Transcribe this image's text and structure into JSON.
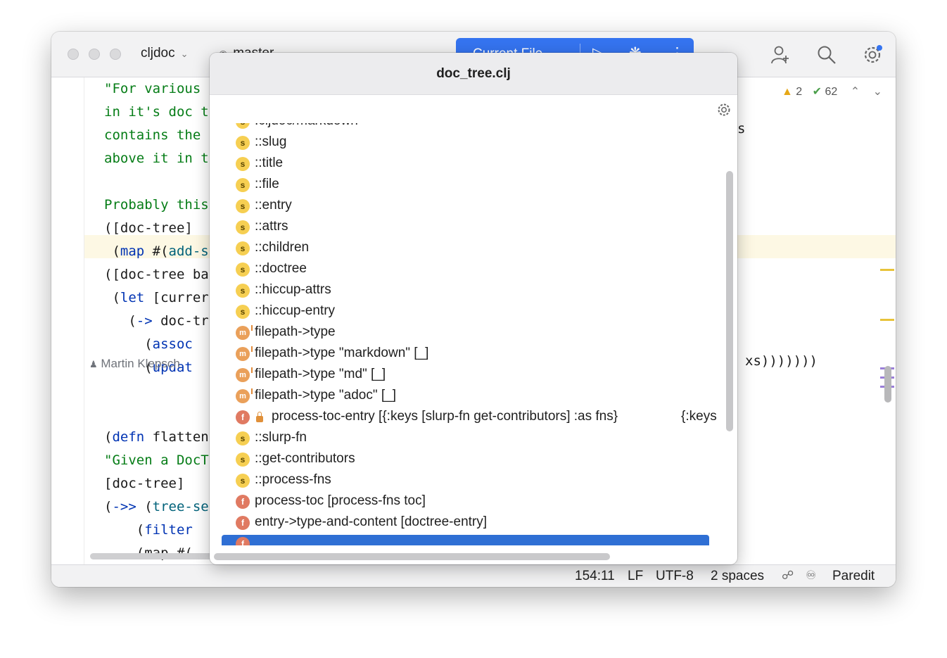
{
  "titlebar": {
    "project": "cljdoc",
    "branch": "master",
    "run_config": "Current File"
  },
  "editor": {
    "lines": [
      {
        "segments": [
          {
            "t": "\"For various ",
            "c": "str"
          }
        ]
      },
      {
        "segments": [
          {
            "t": "in it's doc t",
            "c": "str"
          }
        ]
      },
      {
        "segments": [
          {
            "t": "contains the ",
            "c": "str"
          }
        ]
      },
      {
        "segments": [
          {
            "t": "above it in t",
            "c": "str"
          }
        ]
      },
      {
        "segments": [
          {
            "t": "",
            "c": ""
          }
        ]
      },
      {
        "segments": [
          {
            "t": "Probably this",
            "c": "str"
          }
        ]
      },
      {
        "segments": [
          {
            "t": "([doc-tree]",
            "c": ""
          }
        ]
      },
      {
        "segments": [
          {
            "t": " (",
            "c": ""
          },
          {
            "t": "map",
            "c": "kw"
          },
          {
            "t": " #(",
            "c": ""
          },
          {
            "t": "add-s",
            "c": "fn"
          }
        ]
      },
      {
        "segments": [
          {
            "t": "([doc-tree ba",
            "c": ""
          }
        ]
      },
      {
        "segments": [
          {
            "t": " (",
            "c": ""
          },
          {
            "t": "let",
            "c": "kw"
          },
          {
            "t": " [currer",
            "c": ""
          }
        ]
      },
      {
        "segments": [
          {
            "t": "   (",
            "c": ""
          },
          {
            "t": "->",
            "c": "kw"
          },
          {
            "t": " doc-tr",
            "c": ""
          }
        ]
      },
      {
        "segments": [
          {
            "t": "     (",
            "c": ""
          },
          {
            "t": "assoc",
            "c": "kw"
          }
        ]
      },
      {
        "segments": [
          {
            "t": "     (",
            "c": ""
          },
          {
            "t": "updat",
            "c": "kw"
          }
        ]
      },
      {
        "segments": [
          {
            "t": "",
            "c": ""
          }
        ]
      },
      {
        "segments": [
          {
            "t": "",
            "c": ""
          }
        ]
      },
      {
        "segments": [
          {
            "t": "(",
            "c": ""
          },
          {
            "t": "defn",
            "c": "kw"
          },
          {
            "t": " flatten*",
            "c": ""
          }
        ]
      },
      {
        "segments": [
          {
            "t": "\"Given a DocT",
            "c": "str"
          }
        ]
      },
      {
        "segments": [
          {
            "t": "[doc-tree]",
            "c": ""
          }
        ]
      },
      {
        "segments": [
          {
            "t": "(",
            "c": ""
          },
          {
            "t": "->>",
            "c": "kw"
          },
          {
            "t": " (",
            "c": ""
          },
          {
            "t": "tree-se",
            "c": "fn"
          }
        ]
      },
      {
        "segments": [
          {
            "t": "    (",
            "c": ""
          },
          {
            "t": "filter",
            "c": "kw"
          }
        ]
      },
      {
        "segments": [
          {
            "t": "    (map #(",
            "c": ""
          }
        ]
      }
    ],
    "right_fragments": {
      "s_char": "s",
      "xs_close": "xs)))))))"
    },
    "author": "Martin Klepsch",
    "warnings": "2",
    "checks": "62"
  },
  "popup": {
    "title": "doc_tree.clj",
    "items": [
      {
        "kind": "s",
        "label": ":cljdoc/markdown"
      },
      {
        "kind": "s",
        "label": "::slug"
      },
      {
        "kind": "s",
        "label": "::title"
      },
      {
        "kind": "s",
        "label": "::file"
      },
      {
        "kind": "s",
        "label": "::entry"
      },
      {
        "kind": "s",
        "label": "::attrs"
      },
      {
        "kind": "s",
        "label": "::children"
      },
      {
        "kind": "s",
        "label": "::doctree"
      },
      {
        "kind": "s",
        "label": "::hiccup-attrs"
      },
      {
        "kind": "s",
        "label": "::hiccup-entry"
      },
      {
        "kind": "m",
        "label": "filepath->type"
      },
      {
        "kind": "m",
        "label": "filepath->type \"markdown\" [_]"
      },
      {
        "kind": "m",
        "label": "filepath->type \"md\" [_]"
      },
      {
        "kind": "m",
        "label": "filepath->type \"adoc\" [_]"
      },
      {
        "kind": "f",
        "locked": true,
        "label": "process-toc-entry [{:keys [slurp-fn get-contributors] :as fns}",
        "tail": "{:keys"
      },
      {
        "kind": "s",
        "label": "::slurp-fn"
      },
      {
        "kind": "s",
        "label": "::get-contributors"
      },
      {
        "kind": "s",
        "label": "::process-fns"
      },
      {
        "kind": "f",
        "label": "process-toc [process-fns toc]"
      },
      {
        "kind": "f",
        "label": "entry->type-and-content [doctree-entry]"
      },
      {
        "kind": "f",
        "selected": true,
        "label": ""
      }
    ]
  },
  "statusbar": {
    "position": "154:11",
    "line_ending": "LF",
    "encoding": "UTF-8",
    "indent": "2 spaces",
    "mode": "Paredit"
  },
  "colors": {
    "accent": "#3574f0",
    "selection": "#2f6fd4",
    "string": "#067d17",
    "keyword": "#0033b3"
  }
}
